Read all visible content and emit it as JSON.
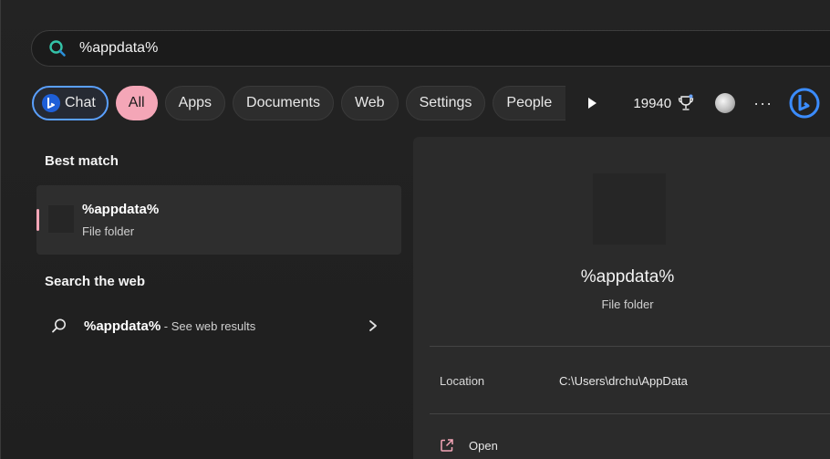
{
  "search": {
    "icon": "bing-search-icon",
    "value": "%appdata%"
  },
  "filters": {
    "chat_label": "Chat",
    "items": [
      "All",
      "Apps",
      "Documents",
      "Web",
      "Settings",
      "People"
    ],
    "active": "All",
    "points": "19940",
    "more_label": "···"
  },
  "best_match": {
    "title": "Best match",
    "name": "%appdata%",
    "type": "File folder"
  },
  "web": {
    "title": "Search the web",
    "query": "%appdata%",
    "suffix": " - See web results"
  },
  "preview": {
    "name": "%appdata%",
    "type": "File folder",
    "location_label": "Location",
    "location_value": "C:\\Users\\drchu\\AppData",
    "open_label": "Open"
  },
  "colors": {
    "accent_pink": "#f4a6b7",
    "chat_border": "#5aa0ff",
    "background": "#202020"
  }
}
